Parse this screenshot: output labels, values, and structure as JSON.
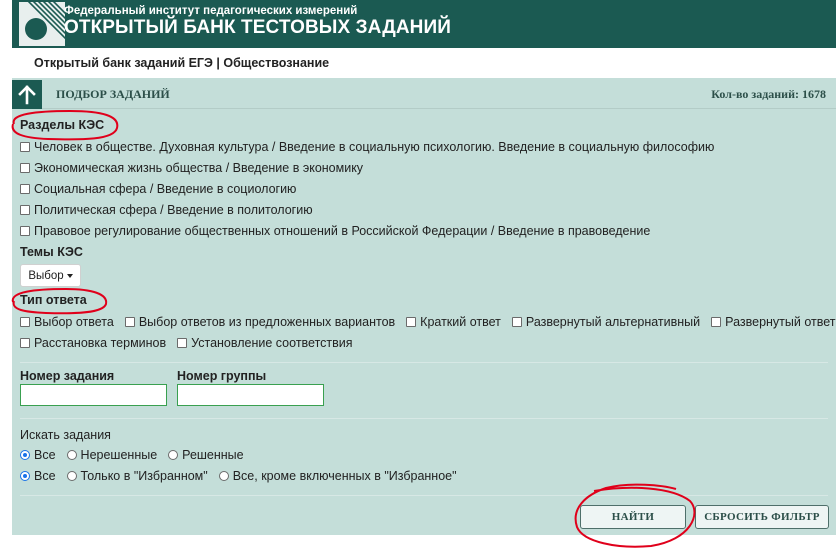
{
  "header": {
    "org": "Федеральный институт педагогических измерений",
    "site": "ОТКРЫТЫЙ БАНК ТЕСТОВЫХ ЗАДАНИЙ"
  },
  "breadcrumb": "Открытый банк заданий ЕГЭ | Обществознание",
  "panel": {
    "title": "ПОДБОР ЗАДАНИЙ",
    "count": "Кол-во заданий: 1678"
  },
  "kes_sections": {
    "label": "Разделы КЭС",
    "items": [
      "Человек в обществе. Духовная культура / Введение в социальную психологию. Введение в социальную философию",
      "Экономическая жизнь общества / Введение в экономику",
      "Социальная сфера / Введение в социологию",
      "Политическая сфера / Введение в политологию",
      "Правовое регулирование общественных отношений в Российской Федерации / Введение в правоведение"
    ]
  },
  "kes_themes": {
    "label": "Темы КЭС",
    "select": "Выбор"
  },
  "answer_type": {
    "label": "Тип ответа",
    "items": [
      "Выбор ответа",
      "Выбор ответов из предложенных вариантов",
      "Краткий ответ",
      "Развернутый альтернативный",
      "Развернутый ответ",
      "Расстановка терминов",
      "Установление соответствия"
    ]
  },
  "fields": {
    "task_number": "Номер задания",
    "group_number": "Номер группы"
  },
  "search": {
    "label": "Искать задания",
    "status_options": [
      "Все",
      "Нерешенные",
      "Решенные"
    ],
    "favorites_options": [
      "Все",
      "Только в \"Избранном\"",
      "Все, кроме включенных в \"Избранное\""
    ],
    "status_selected": "Все",
    "favorites_selected": "Все"
  },
  "buttons": {
    "find": "НАЙТИ",
    "reset": "СБРОСИТЬ ФИЛЬТР"
  },
  "colors": {
    "header_bg": "#1b5a52",
    "panel_bg": "#c4ded9",
    "annotation": "#e0001b"
  }
}
